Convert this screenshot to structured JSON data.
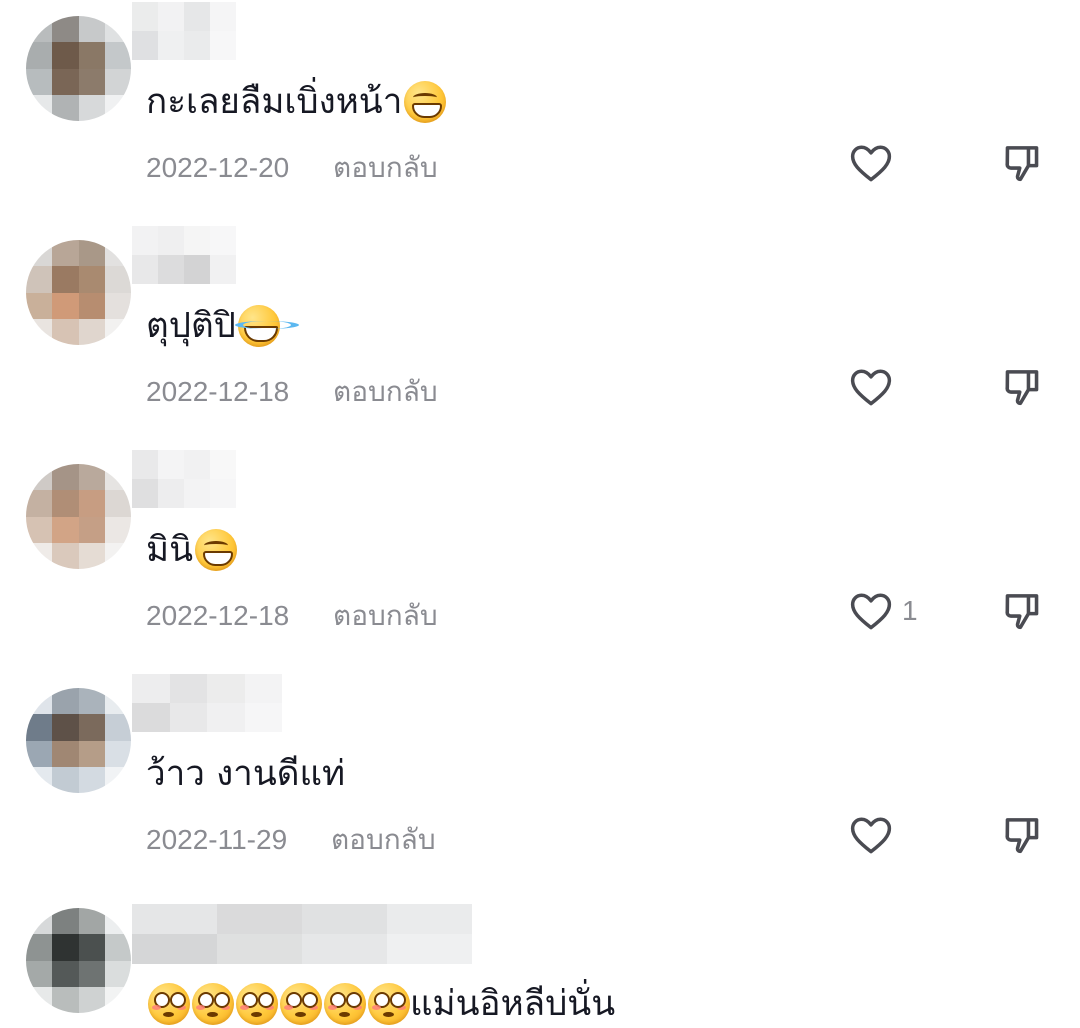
{
  "comments": [
    {
      "text": "กะเลยลืมเบิ่งหน้า",
      "emoji": [
        "grinning-face-icon"
      ],
      "date": "2022-12-20",
      "reply_label": "ตอบกลับ",
      "like_count": ""
    },
    {
      "text": "ตุปุติปิ",
      "emoji": [
        "face-with-tears-of-joy-icon"
      ],
      "date": "2022-12-18",
      "reply_label": "ตอบกลับ",
      "like_count": ""
    },
    {
      "text": "มินิ",
      "emoji": [
        "grinning-face-icon"
      ],
      "date": "2022-12-18",
      "reply_label": "ตอบกลับ",
      "like_count": "1"
    },
    {
      "text": "ว้าว งานดีแท่",
      "emoji": [],
      "date": "2022-11-29",
      "reply_label": "ตอบกลับ",
      "like_count": ""
    },
    {
      "text_suffix": "แม่นอิหลีบ่นั่น",
      "emoji": [
        "flushed-face-icon",
        "flushed-face-icon",
        "flushed-face-icon",
        "flushed-face-icon",
        "flushed-face-icon",
        "flushed-face-icon"
      ]
    }
  ],
  "colors": {
    "text": "#161823",
    "meta": "#8a8b91",
    "icon": "#4a4b52"
  }
}
